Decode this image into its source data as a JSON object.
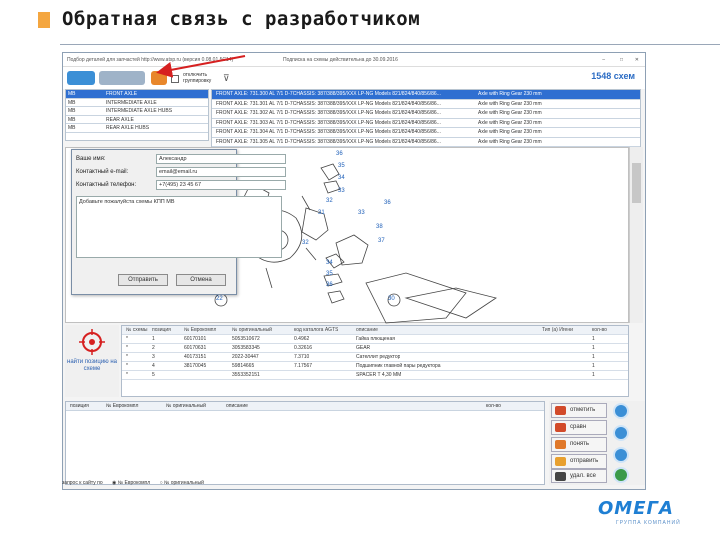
{
  "slide": {
    "title": "Обратная связь с разработчиком"
  },
  "app": {
    "window_title": "Подбор деталей для запчастей http://www.atsp.ru (версия 0.08.01.5C14)",
    "window_note": "Подписка на схемы действительна до 30.09.2016",
    "scheme_count": "1548 схем",
    "toolbar_checkbox": "отключить группировку",
    "left_list": [
      {
        "c1": "MB",
        "c2": "FRONT AXLE",
        "selected": true
      },
      {
        "c1": "MB",
        "c2": "INTERMEDIATE AXLE",
        "selected": false
      },
      {
        "c1": "MB",
        "c2": "INTERMEDIATE AXLE HUBS",
        "selected": false
      },
      {
        "c1": "MB",
        "c2": "REAR AXLE",
        "selected": false
      },
      {
        "c1": "MB",
        "c2": "REAR AXLE HUBS",
        "selected": false
      }
    ],
    "right_list": [
      {
        "c1": "FRONT AXLE: 731.300 AL 7/1 D-7CHASSIS: 387/388/395/XXX LP-NG Models 821/824/840/856/86...",
        "c2": "Axle with Ring Gear 230 mm",
        "selected": true
      },
      {
        "c1": "FRONT AXLE: 731.301 AL 7/1 D-7CHASSIS: 387/388/395/XXX LP-NG Models 821/824/840/856/86...",
        "c2": "Axle with Ring Gear 230 mm",
        "selected": false
      },
      {
        "c1": "FRONT AXLE: 731.302 AL 7/1 D-7CHASSIS: 387/388/395/XXX LP-NG Models 821/824/840/856/86...",
        "c2": "Axle with Ring Gear 230 mm",
        "selected": false
      },
      {
        "c1": "FRONT AXLE: 731.303 AL 7/1 D-7CHASSIS: 387/388/395/XXX LP-NG Models 821/824/840/856/86...",
        "c2": "Axle with Ring Gear 230 mm",
        "selected": false
      },
      {
        "c1": "FRONT AXLE: 731.304 AL 7/1 D-7CHASSIS: 387/388/395/XXX LP-NG Models 821/824/840/856/86...",
        "c2": "Axle with Ring Gear 230 mm",
        "selected": false
      },
      {
        "c1": "FRONT AXLE: 731.305 AL 7/1 D-7CHASSIS: 387/388/395/XXX LP-NG Models 821/824/840/856/86...",
        "c2": "Axle with Ring Gear 230 mm",
        "selected": false
      }
    ],
    "diagram_callouts": [
      "36",
      "35",
      "34",
      "33",
      "32",
      "31",
      "33",
      "36",
      "37",
      "38",
      "32",
      "34",
      "35",
      "36",
      "22",
      "30"
    ],
    "dialog": {
      "name_label": "Ваше имя:",
      "name_value": "Александр",
      "email_label": "Контактный e-mail:",
      "email_value": "email@email.ru",
      "phone_label": "Контактный телефон:",
      "phone_value": "+7(495) 23 45 67",
      "message": "Добавьте пожалуйста схемы КПП МВ",
      "send_button": "Отправить",
      "cancel_button": "Отмена"
    },
    "find_button_label": "найти позицию на схеме",
    "parts_table": {
      "headers": [
        "№ схемы",
        "позиция",
        "№ Еврокомпл",
        "№ оригинальный",
        "код каталога AGTS",
        "описание",
        "Тип (а) Игени",
        "кол-во"
      ],
      "rows": [
        [
          "*",
          "1",
          "60170101",
          "5053510672",
          "0.4962",
          "Гайка плющеная",
          "",
          "1"
        ],
        [
          "*",
          "2",
          "60170631",
          "3053583345",
          "0.32616",
          "GEAR",
          "",
          "1"
        ],
        [
          "*",
          "3",
          "40173151",
          "2022-30447",
          "7.3710",
          "Сателлит редуктор",
          "",
          "1"
        ],
        [
          "*",
          "4",
          "38170045",
          "59814665",
          "7.17567",
          "Подшипник главной пары редуктора",
          "",
          "1"
        ],
        [
          "*",
          "5",
          "",
          "3553352151",
          "",
          "SPACER T 4,30 MM",
          "",
          "1"
        ]
      ]
    },
    "order_table": {
      "headers": [
        "позиция",
        "№ Еврокомпл",
        "№ оригинальный",
        "описание",
        "кол-во"
      ]
    },
    "actions": {
      "mark": "отметить",
      "compare": "сравн",
      "show": "понять",
      "send": "отправить",
      "delete": "удал. все"
    },
    "status": {
      "prefix": "запрос к сайту по",
      "option1": "№ Еврокомпл",
      "option2": "№ оригинальный"
    }
  },
  "logo": {
    "brand": "ОМЕГА",
    "tagline": "ГРУППА КОМПАНИЙ"
  },
  "colors": {
    "accent": "#f4a640",
    "selection": "#2f6fd1",
    "brand": "#1f7fd3",
    "arrow": "#d62020"
  }
}
